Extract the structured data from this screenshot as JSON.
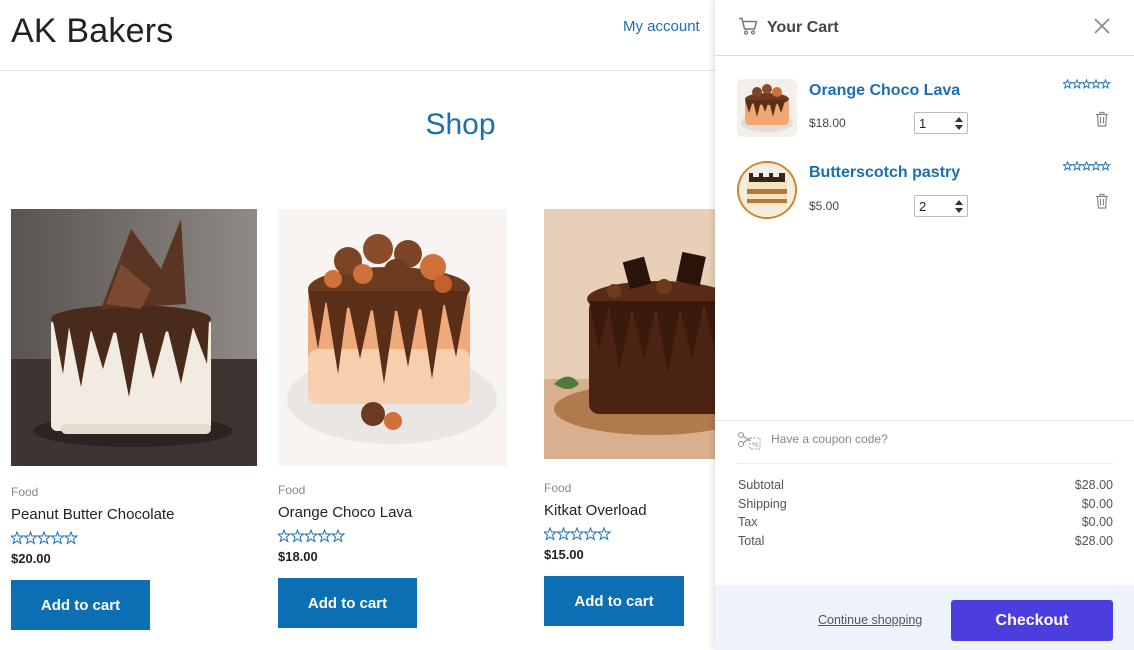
{
  "site": {
    "title": "AK Bakers",
    "nav_account": "My account"
  },
  "shop": {
    "heading": "Shop",
    "products": [
      {
        "category": "Food",
        "name": "Peanut Butter Chocolate",
        "price": "$20.00",
        "button": "Add to cart"
      },
      {
        "category": "Food",
        "name": "Orange Choco Lava",
        "price": "$18.00",
        "button": "Add to cart"
      },
      {
        "category": "Food",
        "name": "Kitkat Overload",
        "price": "$15.00",
        "button": "Add to cart"
      }
    ]
  },
  "cart": {
    "title": "Your Cart",
    "items": [
      {
        "name": "Orange Choco Lava",
        "price": "$18.00",
        "qty": "1"
      },
      {
        "name": "Butterscotch pastry",
        "price": "$5.00",
        "qty": "2"
      }
    ],
    "coupon_text": "Have a coupon code?",
    "totals": {
      "subtotal_label": "Subtotal",
      "subtotal": "$28.00",
      "shipping_label": "Shipping",
      "shipping": "$0.00",
      "tax_label": "Tax",
      "tax": "$0.00",
      "total_label": "Total",
      "total": "$28.00"
    },
    "continue_label": "Continue shopping",
    "checkout_label": "Checkout"
  },
  "colors": {
    "accent": "#1a6fb0",
    "button": "#0c6eb3",
    "checkout": "#4b3dde"
  }
}
